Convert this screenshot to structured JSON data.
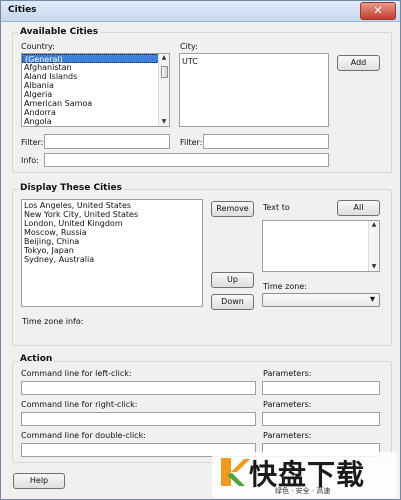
{
  "window": {
    "title": "Cities",
    "close_label": "✕"
  },
  "available": {
    "title": "Available Cities",
    "country_label": "Country:",
    "city_label": "City:",
    "countries": [
      "(General)",
      "Afghanistan",
      "Aland Islands",
      "Albania",
      "Algeria",
      "American Samoa",
      "Andorra",
      "Angola"
    ],
    "cities": [
      "UTC"
    ],
    "add": "Add",
    "filter_label": "Filter:",
    "info_label": "Info:",
    "filter_value": "",
    "info_value": ""
  },
  "display": {
    "title": "Display These Cities",
    "cities": [
      "Los Angeles, United States",
      "New York City, United States",
      "London, United Kingdom",
      "Moscow, Russia",
      "Beijing, China",
      "Tokyo, Japan",
      "Sydney, Australia"
    ],
    "remove": "Remove",
    "up": "Up",
    "down": "Down",
    "text_to": "Text to",
    "all": "All",
    "time_zone": "Time zone:",
    "time_zone_info": "Time zone info:",
    "time_zone_info_value": "-",
    "time_zone_value": ""
  },
  "action": {
    "title": "Action",
    "left_click": "Command line for left-click:",
    "right_click": "Command line for right-click:",
    "double_click": "Command line for double-click:",
    "parameters": "Parameters:"
  },
  "footer": {
    "help": "Help"
  },
  "watermark": {
    "main": "快盘下载",
    "sub": "绿色 · 安全 · 高速"
  },
  "icons": {
    "up": "▲",
    "down": "▼",
    "dropdown": "▾"
  },
  "colors": {
    "selection": "#3d7fdc",
    "logo_orange": "#f39a1c",
    "logo_green": "#4aa63a"
  }
}
